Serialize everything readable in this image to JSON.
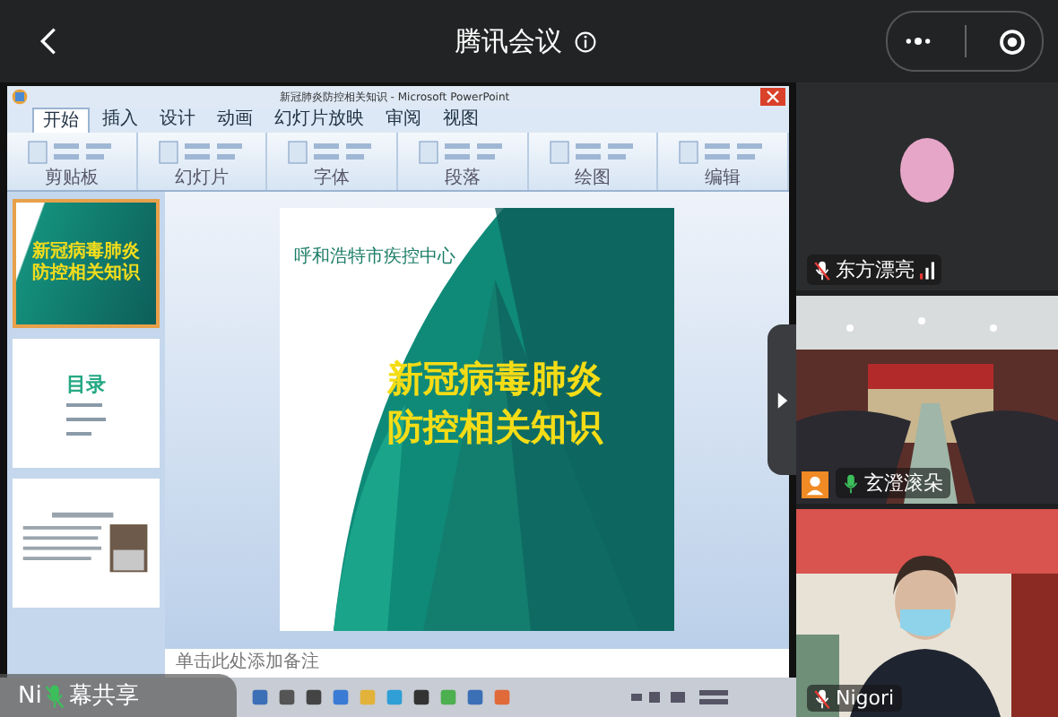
{
  "app_bar": {
    "title": "腾讯会议"
  },
  "shared_screen": {
    "window_title": "新冠肺炎防控相关知识 - Microsoft PowerPoint",
    "ribbon_tabs": [
      {
        "label": "开始",
        "selected": true
      },
      {
        "label": "插入",
        "selected": false
      },
      {
        "label": "设计",
        "selected": false
      },
      {
        "label": "动画",
        "selected": false
      },
      {
        "label": "幻灯片放映",
        "selected": false
      },
      {
        "label": "审阅",
        "selected": false
      },
      {
        "label": "视图",
        "selected": false
      }
    ],
    "ribbon_groups": [
      "剪贴板",
      "幻灯片",
      "字体",
      "段落",
      "绘图",
      "编辑"
    ],
    "thumbnails": [
      {
        "kind": "title",
        "lines": [
          "新冠病毒肺炎",
          "防控相关知识"
        ],
        "selected": true
      },
      {
        "kind": "toc",
        "lines": [
          "目录"
        ],
        "selected": false
      },
      {
        "kind": "text",
        "selected": false
      }
    ],
    "slide": {
      "organization": "呼和浩特市疾控中心",
      "title_lines": [
        "新冠病毒肺炎",
        "防控相关知识"
      ]
    },
    "notes_placeholder": "单击此处添加备注"
  },
  "share_label": {
    "before": "Ni",
    "after": "幕共享",
    "muted": true
  },
  "participants": [
    {
      "kind": "avatar",
      "name": "东方漂亮",
      "muted": true
    },
    {
      "kind": "room",
      "name": "玄澄滚朵",
      "muted": false
    },
    {
      "kind": "person",
      "name": "Nigori",
      "muted": true
    }
  ]
}
